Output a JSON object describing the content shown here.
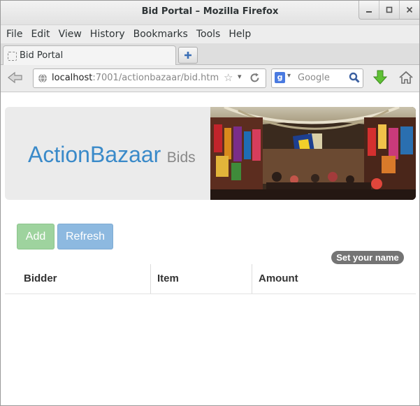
{
  "window": {
    "title": "Bid Portal – Mozilla Firefox"
  },
  "menu": [
    "File",
    "Edit",
    "View",
    "History",
    "Bookmarks",
    "Tools",
    "Help"
  ],
  "tab": {
    "label": "Bid Portal"
  },
  "navbar": {
    "url_host": "localhost",
    "url_path": ":7001/actionbazaar/bid.htm",
    "search_placeholder": "Google",
    "search_engine_letter": "g"
  },
  "hero": {
    "brand_name": "ActionBazaar",
    "brand_sub": "Bids"
  },
  "actions": {
    "add_label": "Add",
    "refresh_label": "Refresh",
    "set_name_label": "Set your name"
  },
  "table": {
    "columns": [
      "Bidder",
      "Item",
      "Amount"
    ],
    "rows": []
  },
  "colors": {
    "brand": "#3a8ac9",
    "add_button": "#9ed39e",
    "refresh_button": "#8db9e0",
    "badge": "#747474"
  },
  "icons": {
    "back": "back-arrow-icon",
    "globe": "globe-icon",
    "bookmark": "star-icon",
    "reload": "reload-icon",
    "search": "magnifier-icon",
    "download": "download-arrow-icon",
    "home": "home-icon",
    "new_tab": "plus-icon"
  }
}
